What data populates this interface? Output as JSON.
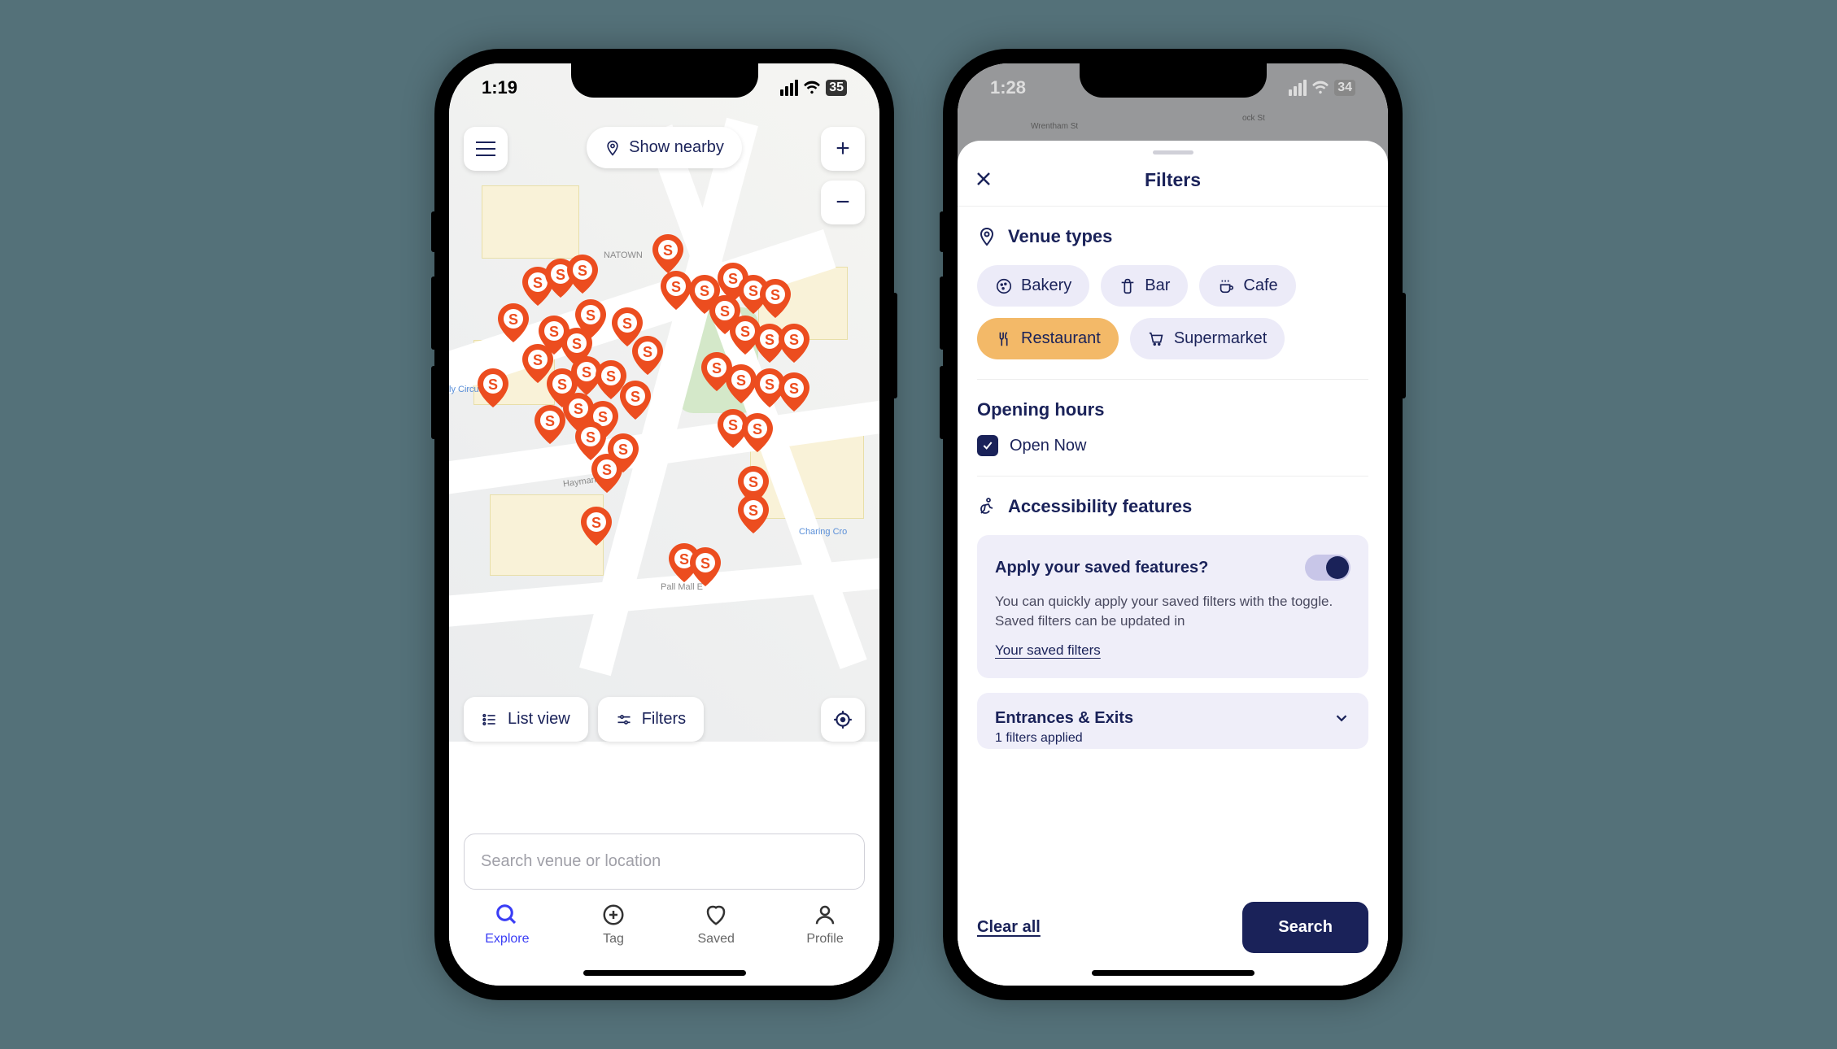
{
  "phone1": {
    "status": {
      "time": "1:19",
      "battery": "35"
    },
    "topbar": {
      "showNearby": "Show nearby"
    },
    "bottom": {
      "listView": "List view",
      "filters": "Filters"
    },
    "search": {
      "placeholder": "Search venue or location"
    },
    "tabs": {
      "explore": "Explore",
      "tag": "Tag",
      "saved": "Saved",
      "profile": "Profile"
    },
    "mapLabels": {
      "chinatown": "NATOWN",
      "haymarket": "Haymarket",
      "pallmall": "Pall Mall E",
      "charing": "Charing Cro",
      "circus": "ly Circus"
    }
  },
  "phone2": {
    "status": {
      "time": "1:28",
      "battery": "34"
    },
    "mapLabels": {
      "wrentham": "Wrentham St",
      "ock": "ock St"
    },
    "sheet": {
      "title": "Filters",
      "venueTypes": {
        "heading": "Venue types",
        "bakery": "Bakery",
        "bar": "Bar",
        "cafe": "Cafe",
        "restaurant": "Restaurant",
        "supermarket": "Supermarket"
      },
      "openingHours": {
        "heading": "Opening hours",
        "openNow": "Open Now"
      },
      "accessibility": {
        "heading": "Accessibility features",
        "card": {
          "title": "Apply your saved features?",
          "desc": "You can quickly apply your saved filters with the toggle. Saved filters can be updated in",
          "link": "Your saved filters"
        },
        "entrances": {
          "title": "Entrances & Exits",
          "sub": "1 filters applied"
        }
      },
      "footer": {
        "clear": "Clear all",
        "search": "Search"
      }
    }
  }
}
